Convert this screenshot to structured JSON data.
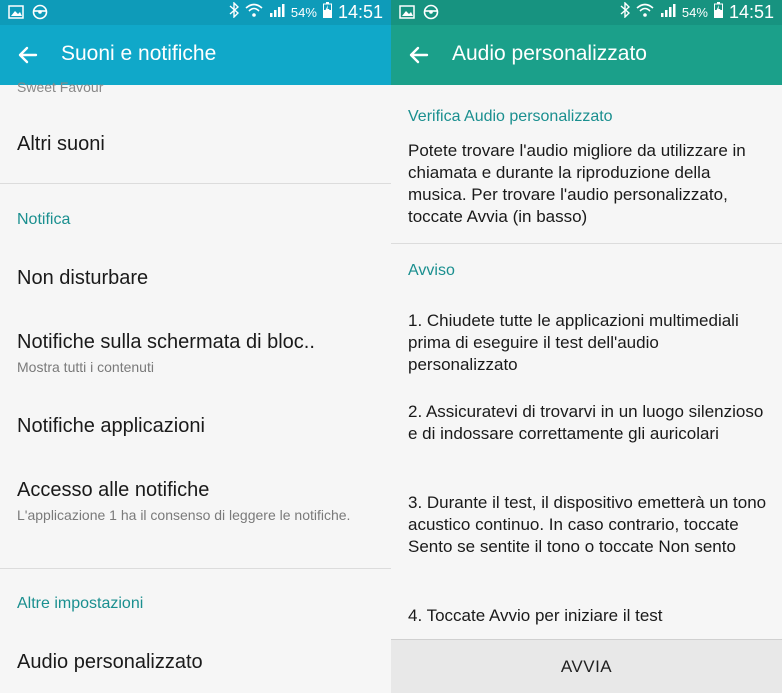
{
  "status_bar": {
    "battery_pct": "54%",
    "time": "14:51"
  },
  "left_screen": {
    "title": "Suoni e notifiche",
    "cut_off_item": "Sweet Favour",
    "items": [
      {
        "label": "Altri suoni"
      }
    ],
    "section_notifica": "Notifica",
    "notifica_items": [
      {
        "label": "Non disturbare",
        "sub": ""
      },
      {
        "label": "Notifiche sulla schermata di bloc..",
        "sub": "Mostra tutti i contenuti"
      },
      {
        "label": "Notifiche applicazioni",
        "sub": ""
      },
      {
        "label": "Accesso alle notifiche",
        "sub": "L'applicazione 1 ha il consenso di leggere le notifiche."
      }
    ],
    "section_altre": "Altre impostazioni",
    "altre_items": [
      {
        "label": "Audio personalizzato"
      }
    ]
  },
  "right_screen": {
    "title": "Audio personalizzato",
    "verify_heading": "Verifica Audio personalizzato",
    "verify_text": "Potete trovare l'audio migliore da utilizzare in chiamata e durante la riproduzione della musica. Per trovare l'audio personalizzato, toccate Avvia (in basso)",
    "warning_heading": "Avviso",
    "steps": [
      "1. Chiudete tutte le applicazioni multimediali prima di eseguire il test dell'audio personalizzato",
      "2. Assicuratevi di trovarvi in un luogo silenzioso e di indossare correttamente gli auricolari",
      "3. Durante il test, il dispositivo emetterà un tono acustico continuo. In caso contrario, toccate Sento se sentite il tono o toccate Non sento",
      "4. Toccate Avvio per iniziare il test"
    ],
    "start_button": "AVVIA"
  },
  "colors": {
    "left_appbar": "#10a8c9",
    "right_appbar": "#1ba08a",
    "section_header": "#1a8f8f"
  },
  "icons": [
    "gallery-icon",
    "steering-wheel-icon",
    "bluetooth-icon",
    "wifi-icon",
    "signal-icon",
    "battery-charging-icon",
    "back-arrow-icon"
  ]
}
